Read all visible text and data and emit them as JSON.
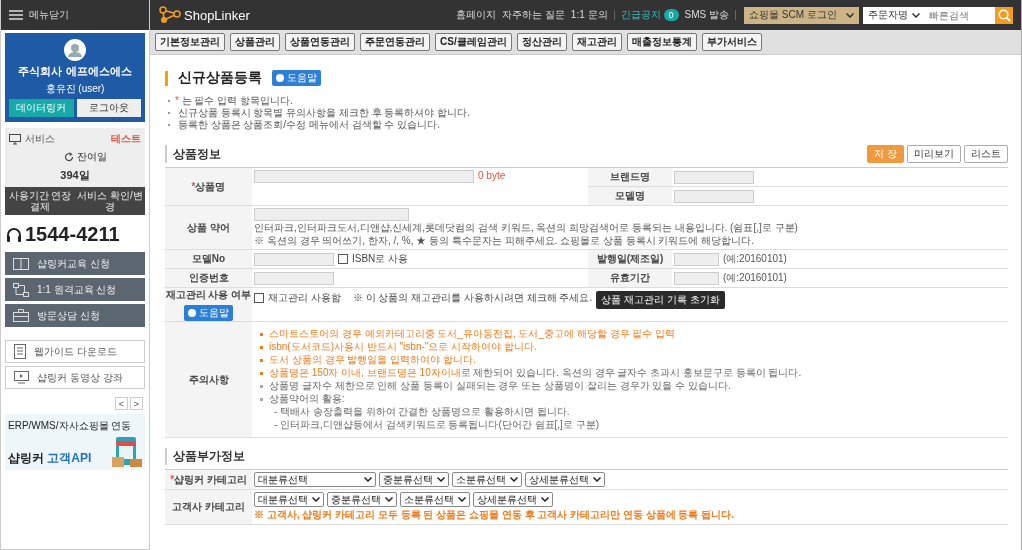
{
  "sidebar": {
    "menu_toggle": "메뉴닫기",
    "company": "주식회사 에프에스에스",
    "user": "홍유진 (user)",
    "profile_buttons": [
      {
        "label": "데이터링커",
        "kind": "primary"
      },
      {
        "label": "로그아웃",
        "kind": "plain"
      }
    ],
    "service_label": "서비스",
    "service_status": "테스트",
    "remaining_label": "잔여일",
    "remaining_days": "394일",
    "service_buttons": [
      "사용기간 연장결제",
      "서비스 확인/변경"
    ],
    "phone": "1544-4211",
    "menu": [
      {
        "label": "샵링커교육 신청",
        "kind": "book"
      },
      {
        "label": "1:1 원격교육 신청",
        "kind": "network"
      },
      {
        "label": "방문상담 신청",
        "kind": "briefcase"
      }
    ],
    "links": [
      {
        "label": "웹가이드 다운로드",
        "kind": "document"
      },
      {
        "label": "샵링커 동영상 강좌",
        "kind": "video"
      }
    ],
    "pager": [
      "<",
      ">"
    ],
    "banner": {
      "line1": "ERP/WMS/자사쇼핑몰 연동",
      "brand": "샵링커",
      "highlight": "고객API"
    }
  },
  "topbar": {
    "logo": "ShopLinker",
    "links": [
      "홈페이지",
      "자주하는 질문",
      "1:1 문의"
    ],
    "notice": {
      "label": "긴급공지",
      "count": "0"
    },
    "sms": "SMS 발송",
    "scm_select": "쇼핑몰 SCM 로그인",
    "search_type": "주문자명",
    "search": {
      "placeholder": "빠른검색"
    }
  },
  "nav": [
    "기본정보관리",
    "상품관리",
    "상품연동관리",
    "주문연동관리",
    "CS/클레임관리",
    "정산관리",
    "재고관리",
    "매출정보통계",
    "부가서비스"
  ],
  "page": {
    "title": "신규상품등록",
    "help": "도움말",
    "notes": [
      {
        "mark": "*",
        "text": "는 필수 입력 항목입니다."
      },
      {
        "text": "신규상품 등록시 항목별 유의사항을 체크한 후 등록하셔야 합니다."
      },
      {
        "text": "등록한 상품은 상품조회/수정 메뉴에서 검색할 수 있습니다."
      }
    ]
  },
  "section1": {
    "title": "상품정보",
    "buttons": [
      {
        "label": "저 장",
        "kind": "primary"
      },
      {
        "label": "미리보기",
        "kind": "plain"
      },
      {
        "label": "리스트",
        "kind": "plain"
      }
    ]
  },
  "form": {
    "product_name": {
      "label": "상품명",
      "required": true,
      "counter": "0 byte"
    },
    "brand": {
      "label": "브랜드명"
    },
    "model_name": {
      "label": "모델명"
    },
    "abbreviation": {
      "label": "상품 약어",
      "help": [
        "인터파크,인터파크도서,디앤샵,신세계,롯데닷컴의 검색 키워드, 옥션의 희망검색어로 등록되는 내용입니다. (쉼표[,]로 구분)",
        "※ 옥션의 경우 띄어쓰기, 한자, /, %, ★ 등의 특수문자는 피해주세요. 쇼핑몰로 상품 등록시 키워드에 해당합니다."
      ]
    },
    "model_no": {
      "label": "모델No",
      "isbn": {
        "label": "ISBN로 사용",
        "checked": false
      }
    },
    "issue_date": {
      "label": "발행일(제조일)",
      "hint": "(예:20160101)"
    },
    "cert_no": {
      "label": "인증번호"
    },
    "expiry": {
      "label": "유효기간",
      "hint": "(예:20160101)"
    },
    "stock": {
      "label": "재고관리 사용 여부",
      "help": "도움말",
      "checkbox": {
        "label": "재고관리 사용함",
        "checked": false
      },
      "note": "※ 이 상품의 재고관리를 사용하시려면 체크해 주세요.",
      "reset_button": "상품 재고관리 기록 초기화"
    },
    "cautions": {
      "label": "주의사항",
      "items": [
        {
          "highlight": "스마트스토어의 경우 예외카테고리중 도서_유아동전집, 도서_중고에 해당할 경우 필수 입력"
        },
        {
          "highlight": "isbn(도서코드)사용시 반드시 \"isbn-\"으로 시작하여야 합니다."
        },
        {
          "highlight": "도서 상품의 경우 발행일을 입력하여야 합니다."
        },
        {
          "highlight": "상품명은 150자 이내, 브랜드명은 10자이내",
          "text": "로 제한되어 있습니다. 옥션의 경우 글자수 초과시 홍보문구로 등록이 됩니다."
        },
        {
          "text": "상품명 글자수 제한으로 인해 상품 등록이 실패되는 경우 또는 상품명이 잘리는 경우가 있을 수 있습니다."
        },
        {
          "text": "상품약어의 활용:",
          "children": [
            "- 택배사 송장출력을 위하여 간결한 상품명으로 활용하시면 됩니다.",
            "- 인터파크,디앤샵등에서 검색키워드로 등록됩니다(단어간 쉼표[,]로 구분)"
          ]
        }
      ]
    }
  },
  "section2": {
    "title": "상품부가정보",
    "rows": [
      {
        "label": "샵링커 카테고리",
        "required": true,
        "wide_first": true,
        "selects": [
          "대분류선택",
          "중분류선택",
          "소분류선택",
          "상세분류선택"
        ]
      },
      {
        "label": "고객사 카테고리",
        "required": false,
        "wide_first": false,
        "selects": [
          "대분류선택",
          "중분류선택",
          "소분류선택",
          "상세분류선택"
        ],
        "note": "※ 고객사, 샵링커 카테고리 모두 등록 된 상품은 쇼핑몰 연동 후 고객사 카테고리만 연동 상품에 등록 됩니다."
      }
    ]
  }
}
